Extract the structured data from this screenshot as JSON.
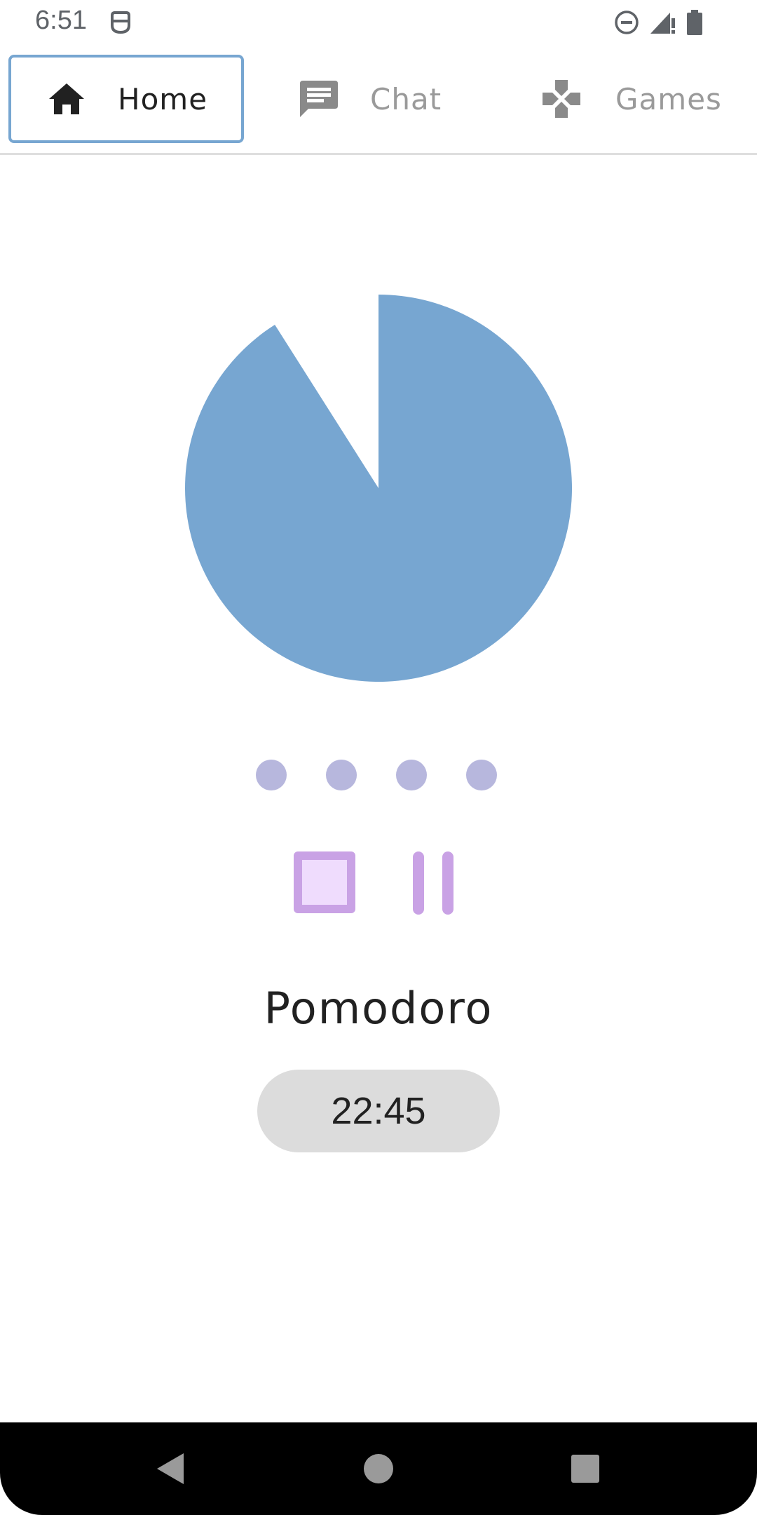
{
  "status_bar": {
    "time": "6:51",
    "icons": [
      "app-notification-icon",
      "do-not-disturb-icon",
      "signal-no-data-icon",
      "battery-icon"
    ]
  },
  "tabs": [
    {
      "label": "Home",
      "icon": "home-icon",
      "active": true
    },
    {
      "label": "Chat",
      "icon": "chat-icon",
      "active": false
    },
    {
      "label": "Games",
      "icon": "gamepad-icon",
      "active": false
    }
  ],
  "timer": {
    "remaining_fraction": 0.91,
    "color": "#77a6d1",
    "session_dots": 4,
    "title": "Pomodoro",
    "time": "22:45"
  },
  "controls": {
    "stop_icon": "stop-icon",
    "pause_icon": "pause-icon",
    "accent": "#c9a2e5"
  },
  "nav_bar": {
    "icons": [
      "back-icon",
      "home-circle-icon",
      "recents-icon"
    ]
  }
}
